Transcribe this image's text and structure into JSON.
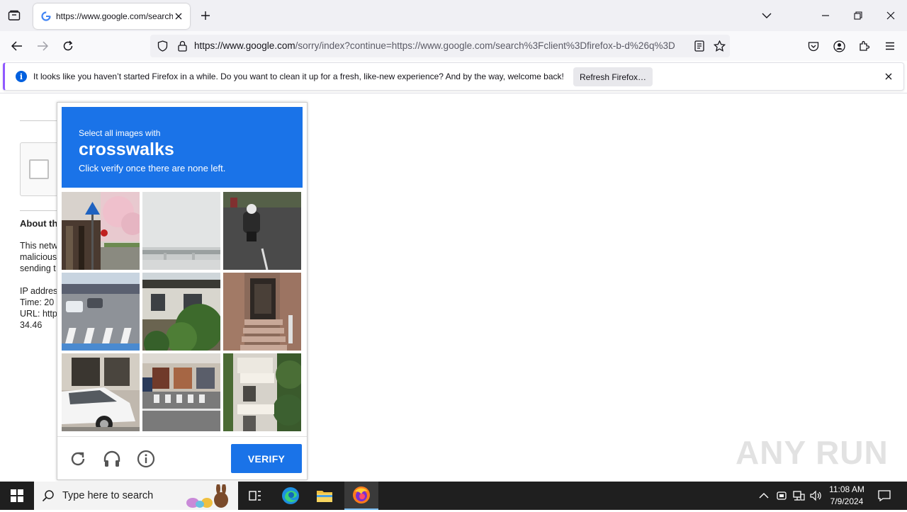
{
  "browser": {
    "tab_title": "https://www.google.com/search",
    "url_host": "https://www.google.com",
    "url_rest": "/sorry/index?continue=https://www.google.com/search%3Fclient%3Dfirefox-b-d%26q%3D"
  },
  "notification": {
    "text": "It looks like you haven’t started Firefox in a while. Do you want to clean it up for a fresh, like-new experience? And by the way, welcome back!",
    "button": "Refresh Firefox…"
  },
  "background_page": {
    "heading": "About th",
    "lines": [
      "This netw",
      "malicious",
      "sending t"
    ],
    "details": [
      "IP addres",
      "Time: 20",
      "URL: http",
      "34.46"
    ]
  },
  "captcha": {
    "instruction": "Select all images with",
    "target": "crosswalks",
    "hint": "Click verify once there are none left.",
    "verify_label": "VERIFY",
    "tiles": [
      "pedestrian-sign-and-shed",
      "foggy-overpass",
      "motorcyclist-on-road",
      "intersection-with-crosswalk",
      "house-with-bushes",
      "building-doorway-steps",
      "parked-white-car",
      "storefront-with-crosswalk",
      "apartment-balconies"
    ]
  },
  "watermark": "ANY RUN",
  "taskbar": {
    "search_placeholder": "Type here to search",
    "time": "11:08 AM",
    "date": "7/9/2024"
  }
}
